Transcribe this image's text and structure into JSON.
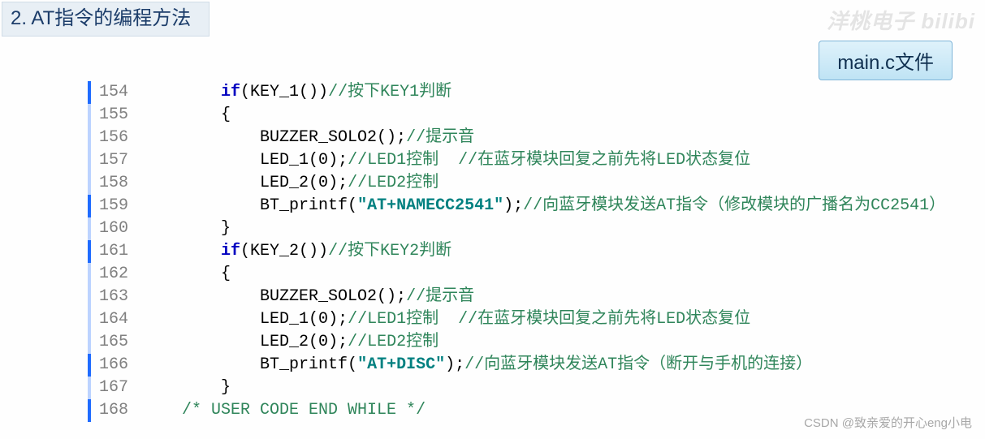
{
  "heading": "2. AT指令的编程方法",
  "file_badge": "main.c文件",
  "watermark_top": "洋桃电子 bilibi",
  "watermark_bottom": "CSDN @致亲爱的开心eng小电",
  "code_start_line": 154,
  "marked_lines": [
    154,
    159,
    161,
    166,
    168
  ],
  "code": {
    "lines": [
      {
        "n": 154,
        "indent": 2,
        "segs": [
          {
            "t": "if",
            "c": "kw"
          },
          {
            "t": "(KEY_1())",
            "c": "paren"
          },
          {
            "t": "//按下KEY1判断",
            "c": "cmt"
          }
        ]
      },
      {
        "n": 155,
        "indent": 2,
        "segs": [
          {
            "t": "{",
            "c": "paren"
          }
        ]
      },
      {
        "n": 156,
        "indent": 3,
        "segs": [
          {
            "t": "BUZZER_SOLO2();",
            "c": "paren"
          },
          {
            "t": "//提示音",
            "c": "cmt"
          }
        ]
      },
      {
        "n": 157,
        "indent": 3,
        "segs": [
          {
            "t": "LED_1(",
            "c": "paren"
          },
          {
            "t": "0",
            "c": "num"
          },
          {
            "t": ");",
            "c": "paren"
          },
          {
            "t": "//LED1控制  //在蓝牙模块回复之前先将LED状态复位",
            "c": "cmt"
          }
        ]
      },
      {
        "n": 158,
        "indent": 3,
        "segs": [
          {
            "t": "LED_2(",
            "c": "paren"
          },
          {
            "t": "0",
            "c": "num"
          },
          {
            "t": ");",
            "c": "paren"
          },
          {
            "t": "//LED2控制",
            "c": "cmt"
          }
        ]
      },
      {
        "n": 159,
        "indent": 3,
        "segs": [
          {
            "t": "BT_printf(",
            "c": "paren"
          },
          {
            "t": "\"AT+NAMECC2541\"",
            "c": "str"
          },
          {
            "t": ");",
            "c": "paren"
          },
          {
            "t": "//向蓝牙模块发送AT指令（修改模块的广播名为CC2541）",
            "c": "cmt"
          }
        ]
      },
      {
        "n": 160,
        "indent": 2,
        "segs": [
          {
            "t": "}",
            "c": "paren"
          }
        ]
      },
      {
        "n": 161,
        "indent": 2,
        "segs": [
          {
            "t": "if",
            "c": "kw"
          },
          {
            "t": "(KEY_2())",
            "c": "paren"
          },
          {
            "t": "//按下KEY2判断",
            "c": "cmt"
          }
        ]
      },
      {
        "n": 162,
        "indent": 2,
        "segs": [
          {
            "t": "{",
            "c": "paren"
          }
        ]
      },
      {
        "n": 163,
        "indent": 3,
        "segs": [
          {
            "t": "BUZZER_SOLO2();",
            "c": "paren"
          },
          {
            "t": "//提示音",
            "c": "cmt"
          }
        ]
      },
      {
        "n": 164,
        "indent": 3,
        "segs": [
          {
            "t": "LED_1(",
            "c": "paren"
          },
          {
            "t": "0",
            "c": "num"
          },
          {
            "t": ");",
            "c": "paren"
          },
          {
            "t": "//LED1控制  //在蓝牙模块回复之前先将LED状态复位",
            "c": "cmt"
          }
        ]
      },
      {
        "n": 165,
        "indent": 3,
        "segs": [
          {
            "t": "LED_2(",
            "c": "paren"
          },
          {
            "t": "0",
            "c": "num"
          },
          {
            "t": ");",
            "c": "paren"
          },
          {
            "t": "//LED2控制",
            "c": "cmt"
          }
        ]
      },
      {
        "n": 166,
        "indent": 3,
        "segs": [
          {
            "t": "BT_printf(",
            "c": "paren"
          },
          {
            "t": "\"AT+DISC\"",
            "c": "str"
          },
          {
            "t": ");",
            "c": "paren"
          },
          {
            "t": "//向蓝牙模块发送AT指令（断开与手机的连接）",
            "c": "cmt"
          }
        ]
      },
      {
        "n": 167,
        "indent": 2,
        "segs": [
          {
            "t": "}",
            "c": "paren"
          }
        ]
      },
      {
        "n": 168,
        "indent": 1,
        "segs": [
          {
            "t": "/* USER CODE END WHILE */",
            "c": "cmt"
          }
        ]
      }
    ]
  }
}
